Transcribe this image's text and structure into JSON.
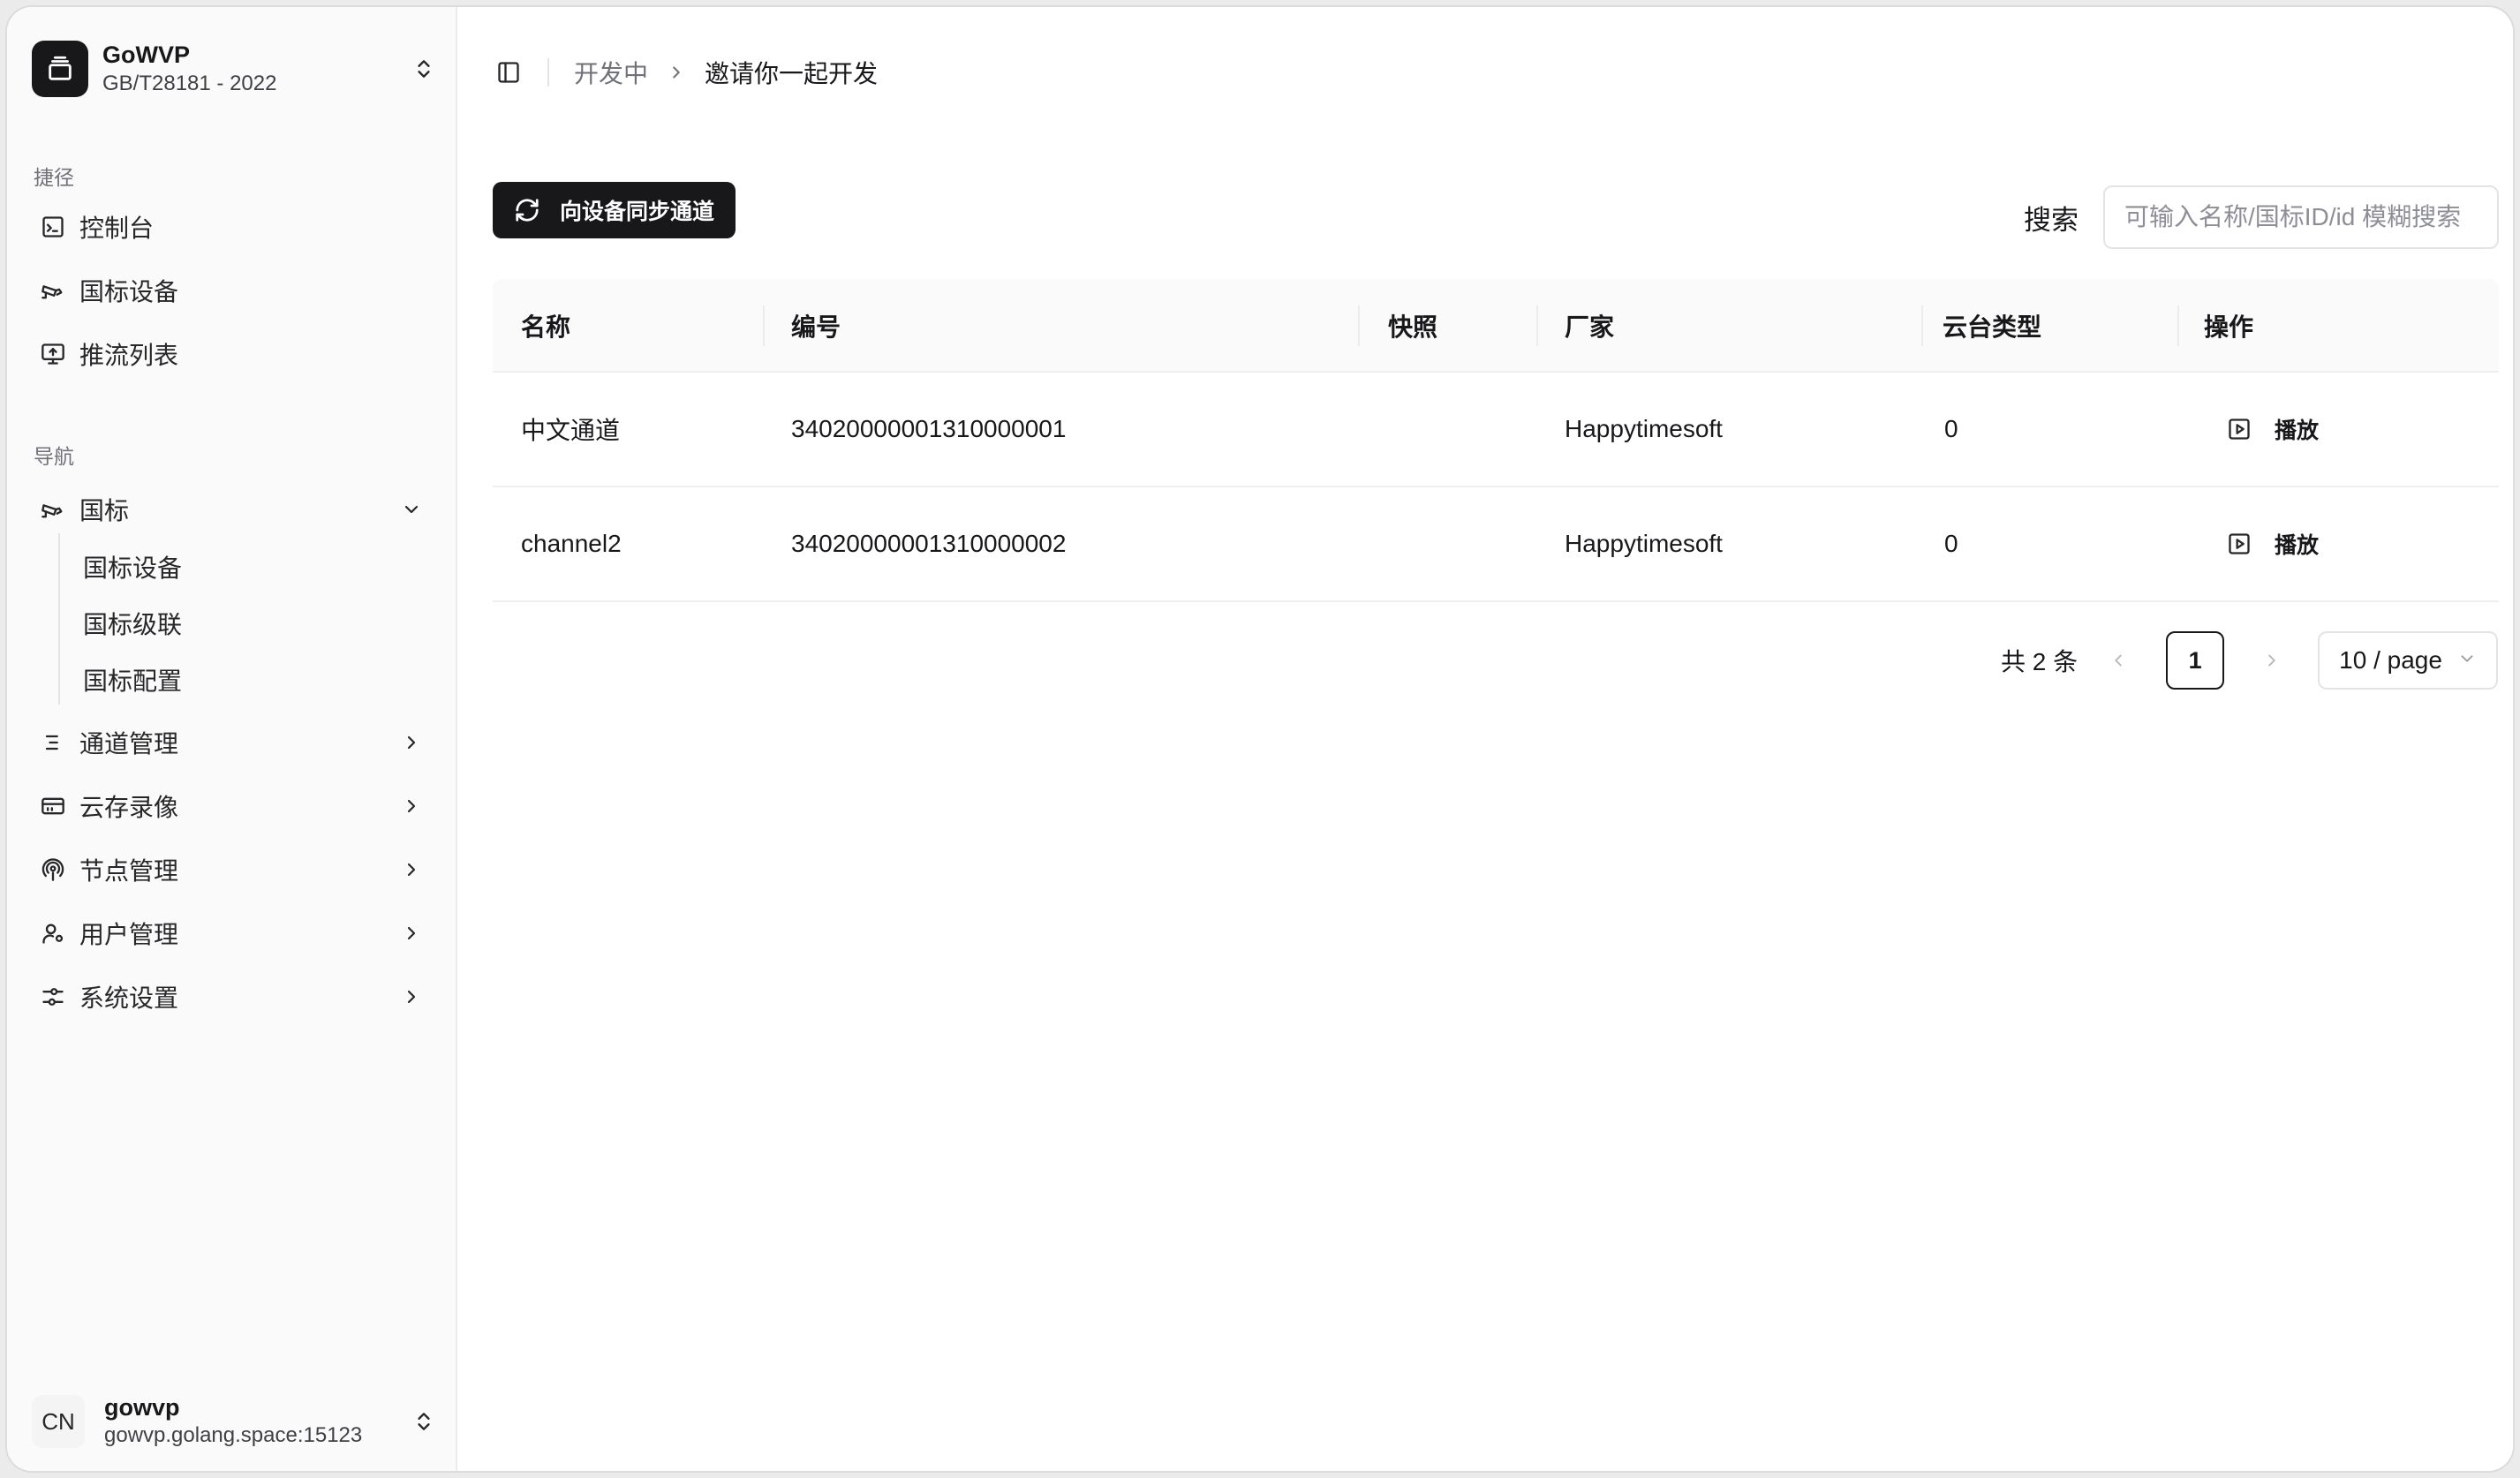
{
  "brand": {
    "name": "GoWVP",
    "subtitle": "GB/T28181 - 2022"
  },
  "sidebar": {
    "shortcuts_label": "捷径",
    "shortcuts": [
      {
        "label": "控制台",
        "icon": "terminal-icon"
      },
      {
        "label": "国标设备",
        "icon": "camera-icon"
      },
      {
        "label": "推流列表",
        "icon": "screen-upload-icon"
      }
    ],
    "nav_label": "导航",
    "nav": [
      {
        "label": "国标",
        "icon": "camera-icon",
        "expanded": true,
        "children": [
          "国标设备",
          "国标级联",
          "国标配置"
        ]
      },
      {
        "label": "通道管理",
        "icon": "list-icon"
      },
      {
        "label": "云存录像",
        "icon": "storage-icon"
      },
      {
        "label": "节点管理",
        "icon": "podcast-icon"
      },
      {
        "label": "用户管理",
        "icon": "user-cog-icon"
      },
      {
        "label": "系统设置",
        "icon": "sliders-icon"
      }
    ]
  },
  "user": {
    "avatar": "CN",
    "name": "gowvp",
    "host": "gowvp.golang.space:15123"
  },
  "breadcrumb": {
    "parent": "开发中",
    "current": "邀请你一起开发"
  },
  "toolbar": {
    "sync_label": "向设备同步通道",
    "search_label": "搜索",
    "search_placeholder": "可输入名称/国标ID/id 模糊搜索",
    "search_value": ""
  },
  "table": {
    "columns": [
      "名称",
      "编号",
      "快照",
      "厂家",
      "云台类型",
      "操作"
    ],
    "rows": [
      {
        "name": "中文通道",
        "id": "34020000001310000001",
        "snapshot": "",
        "vendor": "Happytimesoft",
        "ptz": "0",
        "action": "播放"
      },
      {
        "name": "channel2",
        "id": "34020000001310000002",
        "snapshot": "",
        "vendor": "Happytimesoft",
        "ptz": "0",
        "action": "播放"
      }
    ]
  },
  "pagination": {
    "total": "共 2 条",
    "current": "1",
    "page_size": "10 / page"
  },
  "colors": {
    "primary": "#18181b",
    "sidebar_bg": "#fafafa",
    "muted": "#71717a"
  }
}
